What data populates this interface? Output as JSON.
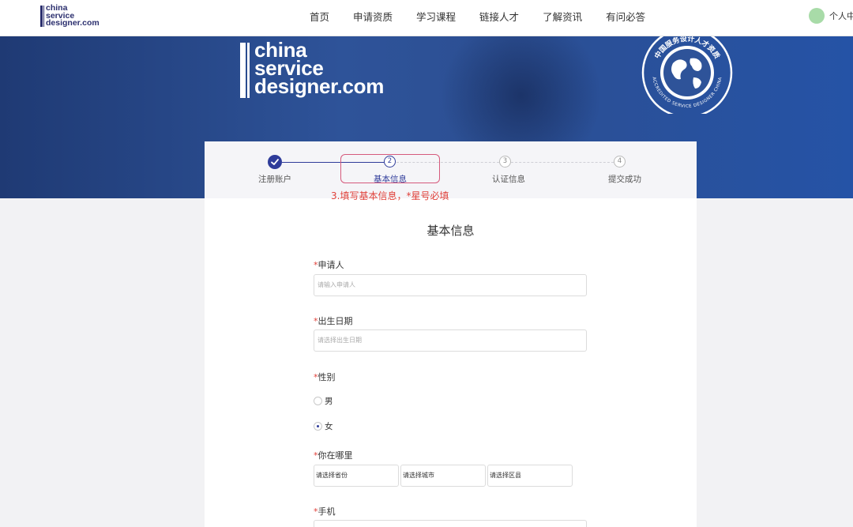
{
  "nav": {
    "logo_lines": [
      "china",
      "service",
      "designer.com"
    ],
    "items": [
      {
        "label": "首页"
      },
      {
        "label": "申请资质"
      },
      {
        "label": "学习课程"
      },
      {
        "label": "链接人才"
      },
      {
        "label": "了解资讯"
      },
      {
        "label": "有问必答"
      }
    ],
    "user_label": "个人中"
  },
  "banner": {
    "logo_lines": [
      "china",
      "service",
      "designer.com"
    ],
    "seal_top_text": "中国服务设计人才资质",
    "seal_bottom_text": "ACCREDITED SERVICE DESIGNER CHINA"
  },
  "steps": [
    {
      "num": "",
      "label": "注册账户",
      "state": "done"
    },
    {
      "num": "2",
      "label": "基本信息",
      "state": "current"
    },
    {
      "num": "3",
      "label": "认证信息",
      "state": "pending"
    },
    {
      "num": "4",
      "label": "提交成功",
      "state": "pending"
    }
  ],
  "annotation": "3.填写基本信息，*星号必填",
  "form": {
    "title": "基本信息",
    "required_mark": "*",
    "applicant": {
      "label": "申请人",
      "placeholder": "请输入申请人"
    },
    "birth_date": {
      "label": "出生日期",
      "placeholder": "请选择出生日期"
    },
    "gender": {
      "label": "性别",
      "options": [
        "男",
        "女"
      ],
      "selected": "女"
    },
    "location": {
      "label": "你在哪里",
      "province": "请选择省份",
      "city": "请选择城市",
      "district": "请选择区县"
    },
    "phone": {
      "label": "手机"
    }
  },
  "colors": {
    "accent": "#2f3c9a",
    "annotation": "#e0413a",
    "highlight": "#d65a7c",
    "banner": "#2e5399"
  }
}
